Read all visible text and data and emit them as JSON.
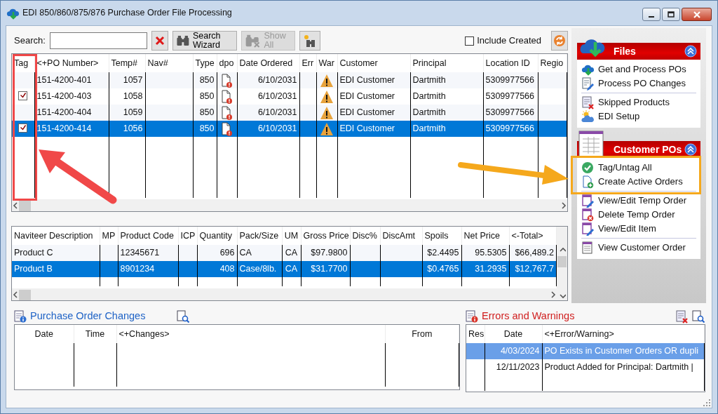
{
  "window": {
    "title": "EDI 850/860/875/876 Purchase Order File Processing"
  },
  "toolbar": {
    "search_label": "Search:",
    "buttons": [
      {
        "kind": "clear",
        "disabled": false
      },
      {
        "kind": "wizard",
        "label": "Search Wizard",
        "disabled": false
      },
      {
        "kind": "showall",
        "label": "Show All",
        "disabled": true
      },
      {
        "kind": "find",
        "disabled": false
      }
    ],
    "include_created": {
      "label": "Include Created",
      "checked": false
    }
  },
  "po_grid": {
    "columns": [
      {
        "label": "Tag",
        "kind": "tag"
      },
      {
        "label": "<+PO Number>",
        "kind": "text"
      },
      {
        "label": "Temp#",
        "kind": "number"
      },
      {
        "label": "Nav#",
        "kind": "blank"
      },
      {
        "label": "Type",
        "kind": "number"
      },
      {
        "label": "dpo",
        "kind": "doc"
      },
      {
        "label": "Date Ordered",
        "kind": "number"
      },
      {
        "label": "Err",
        "kind": "blank"
      },
      {
        "label": "War",
        "kind": "warning"
      },
      {
        "label": "Customer",
        "kind": "text"
      },
      {
        "label": "Principal",
        "kind": "text"
      },
      {
        "label": "Location ID",
        "kind": "text"
      },
      {
        "label": "Regio",
        "kind": "blank"
      }
    ],
    "rows": [
      {
        "tagged": false,
        "selected": false,
        "cells": [
          "",
          "151-4200-401",
          "1057",
          "",
          "850",
          "",
          "6/10/2031",
          "",
          "",
          "EDI Customer",
          "Dartmith",
          "5309977566",
          ""
        ]
      },
      {
        "tagged": true,
        "selected": false,
        "cells": [
          "",
          "151-4200-403",
          "1058",
          "",
          "850",
          "",
          "6/10/2031",
          "",
          "",
          "EDI Customer",
          "Dartmith",
          "5309977566",
          ""
        ]
      },
      {
        "tagged": false,
        "selected": false,
        "cells": [
          "",
          "151-4200-404",
          "1059",
          "",
          "850",
          "",
          "6/10/2031",
          "",
          "",
          "EDI Customer",
          "Dartmith",
          "5309977566",
          ""
        ]
      },
      {
        "tagged": true,
        "selected": true,
        "cells": [
          "",
          "151-4200-414",
          "1056",
          "",
          "850",
          "",
          "6/10/2031",
          "",
          "",
          "EDI Customer",
          "Dartmith",
          "5309977566",
          ""
        ]
      }
    ]
  },
  "items_grid": {
    "columns": [
      {
        "label": "Naviteer Description",
        "kind": "text"
      },
      {
        "label": "MP",
        "kind": "blank"
      },
      {
        "label": "Product Code",
        "kind": "text"
      },
      {
        "label": "ICP",
        "kind": "blank"
      },
      {
        "label": "Quantity",
        "kind": "number"
      },
      {
        "label": "Pack/Size",
        "kind": "text"
      },
      {
        "label": "UM",
        "kind": "center"
      },
      {
        "label": "Gross Price",
        "kind": "number"
      },
      {
        "label": "Disc%",
        "kind": "blank"
      },
      {
        "label": "DiscAmt",
        "kind": "blank"
      },
      {
        "label": "Spoils",
        "kind": "number"
      },
      {
        "label": "Net Price",
        "kind": "number"
      },
      {
        "label": "<-Total>",
        "kind": "number"
      }
    ],
    "rows": [
      {
        "selected": false,
        "cells": [
          "Product C",
          "",
          "12345671",
          "",
          "696",
          "CA",
          "CA",
          "$97.9800",
          "",
          "",
          "$2.4495",
          "95.5305",
          "$66,489.2"
        ]
      },
      {
        "selected": true,
        "cells": [
          "Product B",
          "",
          "8901234",
          "",
          "408",
          "Case/8lb.",
          "CA",
          "$31.7700",
          "",
          "",
          "$0.4765",
          "31.2935",
          "$12,767.7"
        ]
      }
    ]
  },
  "changes": {
    "title": "Purchase Order Changes",
    "columns": [
      {
        "label": "Date",
        "kind": "center"
      },
      {
        "label": "Time",
        "kind": "center"
      },
      {
        "label": "<+Changes>",
        "kind": "text"
      },
      {
        "label": "From",
        "kind": "center"
      }
    ]
  },
  "errors": {
    "title": "Errors and Warnings",
    "columns": [
      {
        "label": "Res",
        "kind": "blank"
      },
      {
        "label": "Date",
        "kind": "number"
      },
      {
        "label": "<+Error/Warning>",
        "kind": "text"
      }
    ],
    "rows": [
      {
        "selected": true,
        "cells": [
          "",
          "4/03/2024",
          "PO Exists in Customer Orders OR dupli"
        ]
      },
      {
        "selected": false,
        "cells": [
          "",
          "12/11/2023",
          "Product Added for Principal: Dartmith |"
        ]
      }
    ]
  },
  "sidebar": {
    "groups": [
      {
        "title": "Files",
        "expanded": true,
        "sections": [
          [
            "Get and Process POs",
            "Process PO Changes"
          ],
          [
            "Skipped Products",
            "EDI Setup"
          ]
        ]
      },
      {
        "title": "Customer POs",
        "expanded": true,
        "sections": [
          [
            "Tag/Untag All",
            "Create Active Orders"
          ],
          [
            "View/Edit Temp Order",
            "Delete Temp Order",
            "View/Edit Item"
          ],
          [
            "View Customer Order"
          ]
        ]
      }
    ]
  }
}
